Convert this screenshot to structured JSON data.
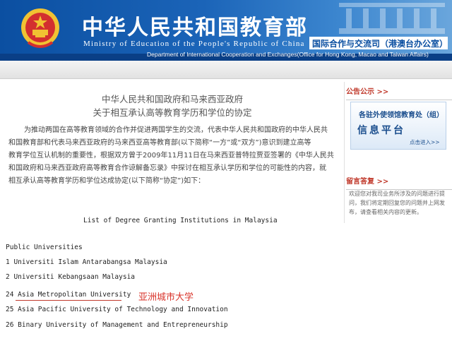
{
  "header": {
    "title_cn": "中华人民共和国教育部",
    "title_en": "Ministry of Education of the People's Republic of China",
    "dept_cn": "国际合作与交流司（港澳台办公室）",
    "dept_en": "Department of International Cooperation and Exchanges(Office for Hong Kong, Macao and Taiwan Affairs)"
  },
  "document": {
    "title_line1": "中华人民共和国政府和马来西亚政府",
    "title_line2": "关于相互承认高等教育学历和学位的协定",
    "paragraph_lines": [
      "为推动两国在高等教育领域的合作并促进两国学生的交流，代表中华人民共和国政府的中华人民共",
      "和国教育部和代表马来西亚政府的马来西亚高等教育部(以下简称“一方”或“双方”)意识到建立高等",
      "教育学位互认机制的重要性，根据双方曾于2009年11月11日在马来西亚普特拉贾亚签署的《中华人民共",
      "和国政府和马来西亚政府高等教育合作谅解备忘录》中探讨在相互承认学历和学位的可能性的内容，就",
      "相互承认高等教育学历和学位达成协定(以下简称“协定”)如下："
    ]
  },
  "sidebar": {
    "notice_heading": "公告公示 >>",
    "notice_line1": "各驻外使领馆教育处（组）",
    "notice_line2": "信息平台",
    "notice_enter": "点击进入>>",
    "qa_heading": "留言答复 >>",
    "qa_text": [
      "欢迎您对我司业务所涉及的问题进行提",
      "问，我们将定期回复您的问题并上网发",
      "布，请查看相关内容的更新。"
    ]
  },
  "list": {
    "title": "List of Degree Granting Institutions in Malaysia",
    "subheading": "Public Universities",
    "items": [
      "1 Universiti Islam Antarabangsa Malaysia",
      "2 Universiti Kebangsaan Malaysia",
      "24 Asia Metropolitan University",
      "25 Asia Pacific University of Technology and Innovation",
      "26 Binary University of Management and Entrepreneurship"
    ],
    "annotation": "亚洲城市大学"
  },
  "colors": {
    "banner_blue": "#0b4fa1",
    "accent_red": "#d9342b"
  }
}
